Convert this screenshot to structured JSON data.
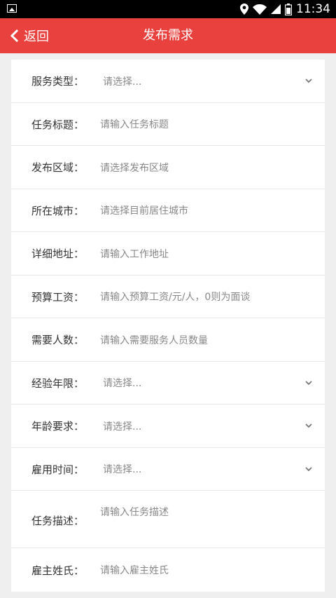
{
  "status_bar": {
    "time": "11:34"
  },
  "app_bar": {
    "back_label": "返回",
    "title": "发布需求"
  },
  "form": {
    "rows": [
      {
        "label": "服务类型：",
        "placeholder": "请选择...",
        "kind": "select"
      },
      {
        "label": "任务标题：",
        "placeholder": "请输入任务标题",
        "kind": "input"
      },
      {
        "label": "发布区域：",
        "placeholder": "请选择发布区域",
        "kind": "input"
      },
      {
        "label": "所在城市：",
        "placeholder": "请选择目前居住城市",
        "kind": "input"
      },
      {
        "label": "详细地址：",
        "placeholder": "请输入工作地址",
        "kind": "input"
      },
      {
        "label": "预算工资：",
        "placeholder": "请输入预算工资/元/人，0则为面谈",
        "kind": "input"
      },
      {
        "label": "需要人数：",
        "placeholder": "请输入需要服务人员数量",
        "kind": "input"
      },
      {
        "label": "经验年限：",
        "placeholder": "请选择...",
        "kind": "select"
      },
      {
        "label": "年龄要求：",
        "placeholder": "请选择...",
        "kind": "select"
      },
      {
        "label": "雇用时间：",
        "placeholder": "请选择...",
        "kind": "select"
      },
      {
        "label": "任务描述：",
        "placeholder": "请输入任务描述",
        "kind": "textarea"
      },
      {
        "label": "雇主姓氏：",
        "placeholder": "请输入雇主姓氏",
        "kind": "input"
      }
    ]
  },
  "colors": {
    "accent": "#e8413e",
    "background": "#efefef"
  }
}
